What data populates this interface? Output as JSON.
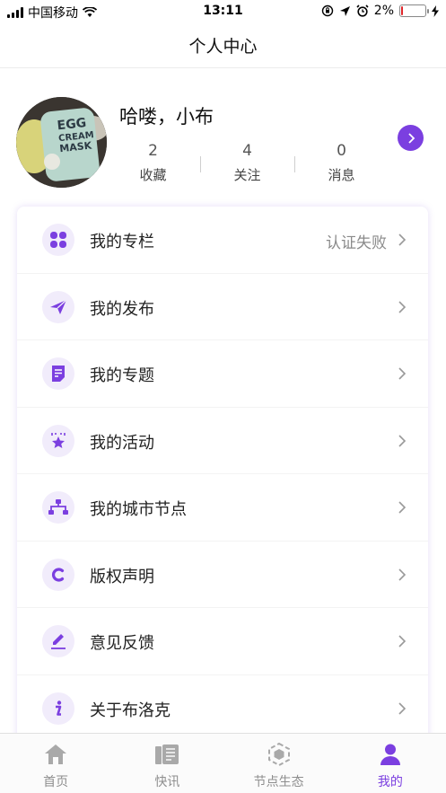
{
  "status_bar": {
    "carrier": "中国移动",
    "time": "13:11",
    "battery_text": "2%",
    "battery_level": 0.02
  },
  "nav": {
    "title": "个人中心"
  },
  "profile": {
    "greeting": "哈喽，小布",
    "avatar_text": [
      "EGG",
      "CREAM",
      "MASK"
    ],
    "stats": [
      {
        "value": "2",
        "label": "收藏"
      },
      {
        "value": "4",
        "label": "关注"
      },
      {
        "value": "0",
        "label": "消息"
      }
    ]
  },
  "menu": [
    {
      "label": "我的专栏",
      "extra": "认证失败",
      "icon": "grid-icon"
    },
    {
      "label": "我的发布",
      "extra": "",
      "icon": "paper-plane-icon"
    },
    {
      "label": "我的专题",
      "extra": "",
      "icon": "document-icon"
    },
    {
      "label": "我的活动",
      "extra": "",
      "icon": "star-badge-icon"
    },
    {
      "label": "我的城市节点",
      "extra": "",
      "icon": "network-icon"
    },
    {
      "label": "版权声明",
      "extra": "",
      "icon": "copyright-icon"
    },
    {
      "label": "意见反馈",
      "extra": "",
      "icon": "edit-icon"
    },
    {
      "label": "关于布洛克",
      "extra": "",
      "icon": "info-icon"
    }
  ],
  "tabs": [
    {
      "label": "首页",
      "icon": "home-icon",
      "active": false
    },
    {
      "label": "快讯",
      "icon": "news-icon",
      "active": false
    },
    {
      "label": "节点生态",
      "icon": "node-icon",
      "active": false
    },
    {
      "label": "我的",
      "icon": "user-icon",
      "active": true
    }
  ],
  "colors": {
    "accent": "#7b3fe0",
    "icon_bg": "#f1ecfb",
    "battery_low": "#e0262a"
  }
}
